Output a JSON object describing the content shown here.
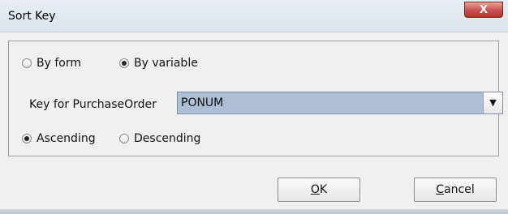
{
  "window": {
    "title": "Sort Key",
    "close_label": "X"
  },
  "sort_by": {
    "options": [
      {
        "label": "By form",
        "checked": false
      },
      {
        "label": "By variable",
        "checked": true
      }
    ]
  },
  "key": {
    "label": "Key for PurchaseOrder",
    "selected": "PONUM"
  },
  "order": {
    "options": [
      {
        "label": "Ascending",
        "checked": true
      },
      {
        "label": "Descending",
        "checked": false
      }
    ]
  },
  "buttons": {
    "ok": {
      "mnemonic": "O",
      "rest": "K"
    },
    "cancel": {
      "mnemonic": "C",
      "rest": "ancel"
    }
  }
}
